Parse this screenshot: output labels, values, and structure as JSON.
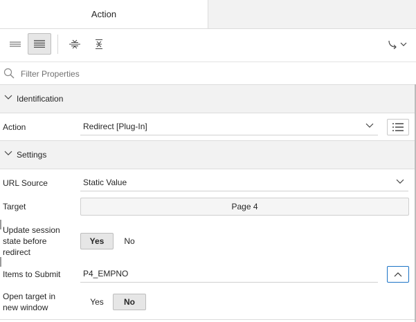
{
  "tabs": [
    {
      "label": "Action",
      "active": true
    }
  ],
  "toolbar": {
    "buttons": [
      {
        "icon": "show-common-icon"
      },
      {
        "icon": "show-all-icon",
        "active": true
      },
      {
        "icon": "collapse-all-icon"
      },
      {
        "icon": "expand-all-icon"
      },
      {
        "icon": "go-to-group-icon"
      }
    ]
  },
  "filter": {
    "placeholder": "Filter Properties",
    "value": ""
  },
  "sections": [
    {
      "title": "Identification"
    },
    {
      "title": "Settings"
    }
  ],
  "identification": {
    "action": {
      "label": "Action",
      "value": "Redirect [Plug-In]"
    }
  },
  "settings": {
    "url_source": {
      "label": "URL Source",
      "value": "Static Value"
    },
    "target": {
      "label": "Target",
      "value": "Page 4"
    },
    "update_session": {
      "label_lines": [
        "Update session",
        "state before",
        "redirect"
      ],
      "yes": "Yes",
      "no": "No",
      "selected": "Yes"
    },
    "items_to_submit": {
      "label": "Items to Submit",
      "value": "P4_EMPNO"
    },
    "open_new_window": {
      "label_lines": [
        "Open target in",
        "new window"
      ],
      "yes": "Yes",
      "no": "No",
      "selected": "No"
    }
  },
  "colors": {
    "accent": "#1a73c6",
    "section_bg": "#f2f2f2",
    "border": "#dcdcdc"
  }
}
